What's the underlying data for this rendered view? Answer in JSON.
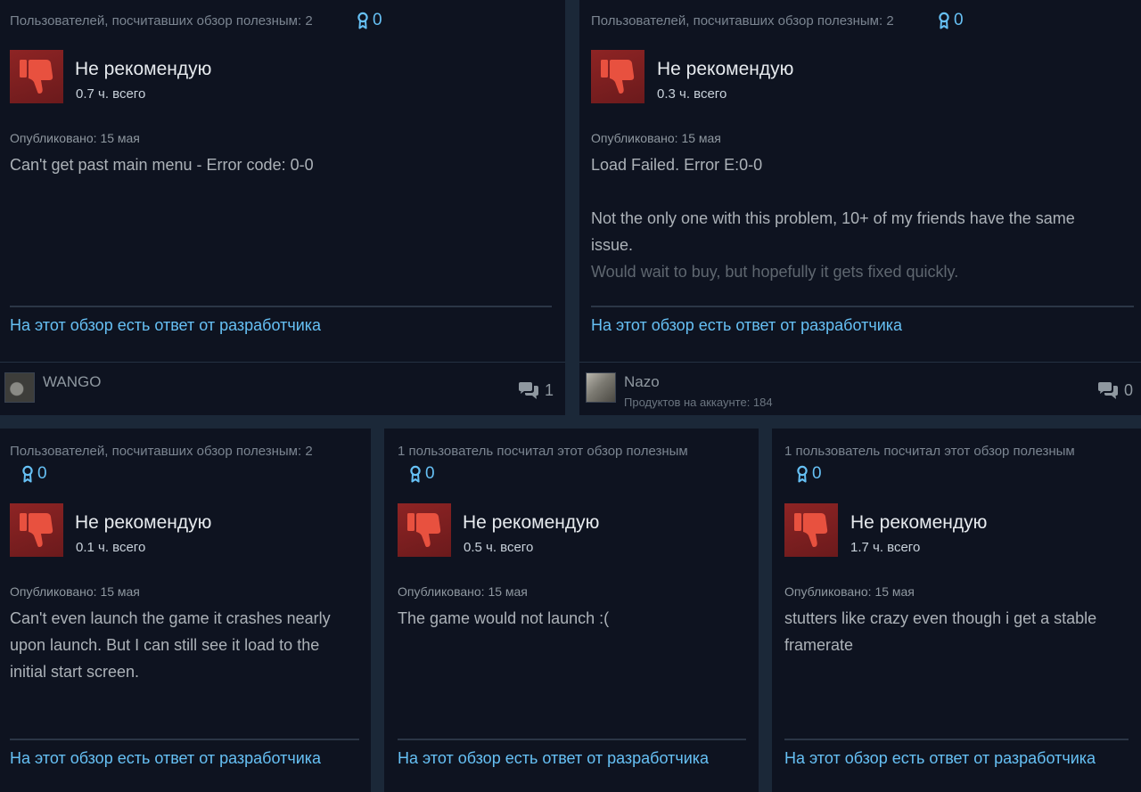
{
  "colors": {
    "background": "#1b2838",
    "card": "#0e1320",
    "link": "#66c0f4",
    "thumb_bg": "#8e2424",
    "thumb_icon": "#e8513f"
  },
  "reviews": [
    {
      "helpful_text": "Пользователей, посчитавших обзор полезным: 2",
      "award_count": "0",
      "award_icon": "award-ribbon-icon",
      "verdict": "Не рекомендую",
      "verdict_icon": "thumbs-down-icon",
      "hours": "0.7 ч. всего",
      "posted": "Опубликовано: 15 мая",
      "text": [
        "Can't get past main menu - Error code: 0-0"
      ],
      "dev_response": "На этот обзор есть ответ от разработчика",
      "author": {
        "name": "WANGO",
        "comments": "1"
      }
    },
    {
      "helpful_text": "Пользователей, посчитавших обзор полезным: 2",
      "award_count": "0",
      "award_icon": "award-ribbon-icon",
      "verdict": "Не рекомендую",
      "verdict_icon": "thumbs-down-icon",
      "hours": "0.3 ч. всего",
      "posted": "Опубликовано: 15 мая",
      "text": [
        "Load Failed. Error E:0-0",
        "Not the only one with this problem, 10+ of my friends have the same issue.",
        "Would wait to buy, but hopefully it gets fixed quickly."
      ],
      "dev_response": "На этот обзор есть ответ от разработчика",
      "author": {
        "name": "Nazo",
        "products": "Продуктов на аккаунте: 184",
        "comments": "0"
      }
    },
    {
      "helpful_text": "Пользователей, посчитавших обзор полезным: 2",
      "award_count": "0",
      "award_icon": "award-ribbon-icon",
      "verdict": "Не рекомендую",
      "verdict_icon": "thumbs-down-icon",
      "hours": "0.1 ч. всего",
      "posted": "Опубликовано: 15 мая",
      "text": [
        "Can't even launch the game it crashes nearly upon launch. But I can still see it load to the initial start screen."
      ],
      "dev_response": "На этот обзор есть ответ от разработчика"
    },
    {
      "helpful_text": "1 пользователь посчитал этот обзор полезным",
      "award_count": "0",
      "award_icon": "award-ribbon-icon",
      "verdict": "Не рекомендую",
      "verdict_icon": "thumbs-down-icon",
      "hours": "0.5 ч. всего",
      "posted": "Опубликовано: 15 мая",
      "text": [
        "The game would not launch :("
      ],
      "dev_response": "На этот обзор есть ответ от разработчика"
    },
    {
      "helpful_text": "1 пользователь посчитал этот обзор полезным",
      "award_count": "0",
      "award_icon": "award-ribbon-icon",
      "verdict": "Не рекомендую",
      "verdict_icon": "thumbs-down-icon",
      "hours": "1.7 ч. всего",
      "posted": "Опубликовано: 15 мая",
      "text": [
        "stutters like crazy even though i get a stable framerate"
      ],
      "dev_response": "На этот обзор есть ответ от разработчика"
    }
  ]
}
